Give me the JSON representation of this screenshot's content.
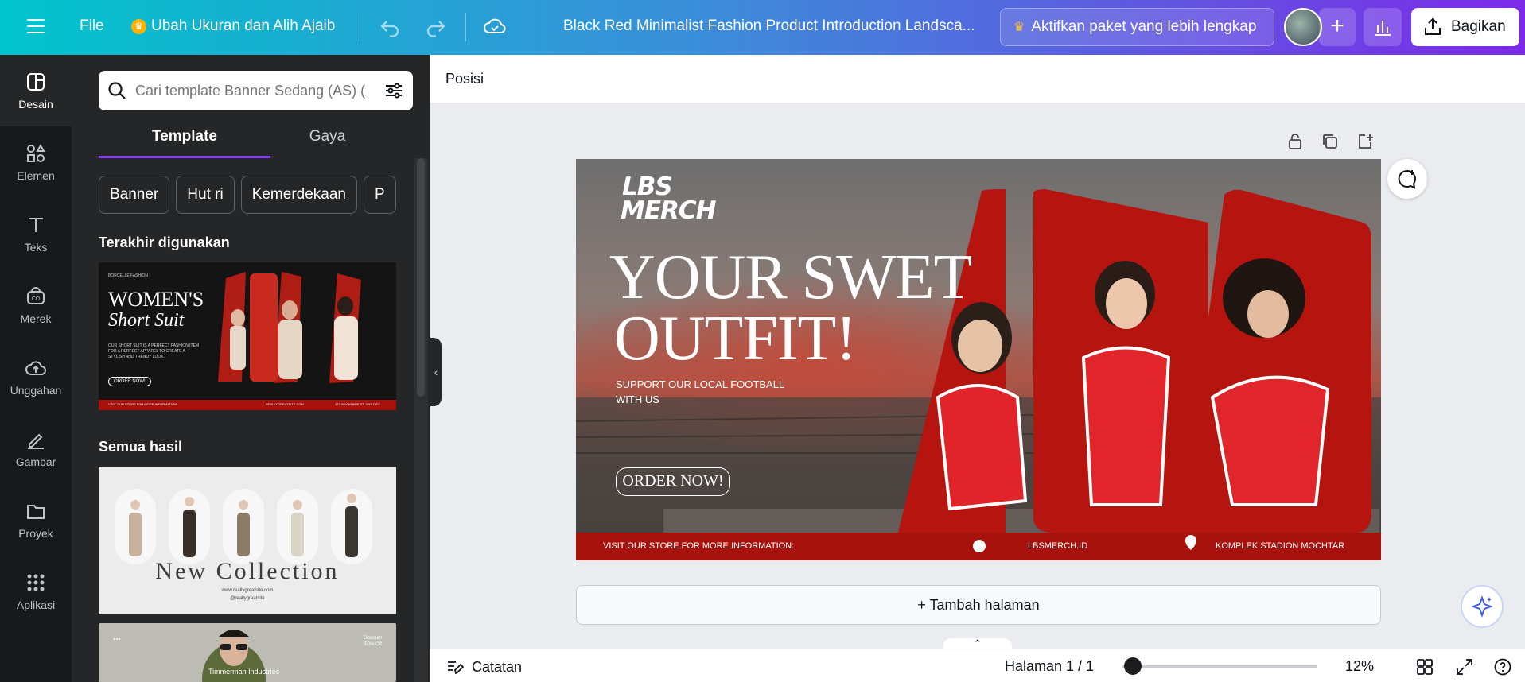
{
  "topbar": {
    "file_label": "File",
    "resize_label": "Ubah Ukuran dan Alih Ajaib",
    "doc_title": "Black Red Minimalist Fashion Product Introduction Landsca...",
    "upgrade_label": "Aktifkan paket yang lebih lengkap",
    "share_label": "Bagikan",
    "icons": [
      "menu-icon",
      "crown-icon",
      "undo-icon",
      "redo-icon",
      "cloud-icon",
      "plus-icon",
      "stats-icon",
      "share-icon"
    ]
  },
  "rail": {
    "items": [
      {
        "label": "Desain",
        "icon": "design-icon"
      },
      {
        "label": "Elemen",
        "icon": "elements-icon"
      },
      {
        "label": "Teks",
        "icon": "text-icon"
      },
      {
        "label": "Merek",
        "icon": "brand-icon"
      },
      {
        "label": "Unggahan",
        "icon": "upload-icon"
      },
      {
        "label": "Gambar",
        "icon": "draw-icon"
      },
      {
        "label": "Proyek",
        "icon": "folder-icon"
      },
      {
        "label": "Aplikasi",
        "icon": "apps-icon"
      }
    ]
  },
  "panel": {
    "search_placeholder": "Cari template Banner Sedang (AS) (",
    "tabs": [
      "Template",
      "Gaya"
    ],
    "chips": [
      "Banner",
      "Hut ri",
      "Kemerdekaan",
      "P"
    ],
    "recent_heading": "Terakhir digunakan",
    "all_heading": "Semua hasil",
    "recent_template": {
      "brand": "BORCELLE FASHION",
      "title_1": "WOMEN'S",
      "title_2": "Short Suit",
      "body": "OUR SHORT SUIT IS A PERFECT FASHION ITEM FOR A PERFECT APPAREL TO CREATE A STYLISH AND TRENDY LOOK.",
      "cta": "ORDER NOW!",
      "footer_left": "VISIT OUR STORE FOR MORE INFORMATION",
      "footer_mid": "REALLYGREATSITE.COM",
      "footer_right": "123 ANYWHERE ST, ANY CITY"
    },
    "result_1": {
      "title": "New Collection",
      "site": "www.reallygreatsite.com",
      "handle": "@reallygreatsite"
    },
    "result_2": {
      "company": "Timmerman Industries",
      "menu": "...",
      "price_1": "Discount",
      "price_2": "50% Off"
    }
  },
  "editor": {
    "position_label": "Posisi",
    "add_page_label": "+ Tambah halaman",
    "page_label": "Halaman 1 / 1",
    "zoom_label": "12%",
    "zoom_level": 0.12,
    "notes_label": "Catatan"
  },
  "design": {
    "logo_1": "LBS",
    "logo_2": "MERCH",
    "headline_1": "YOUR SWET",
    "headline_2": "OUTFIT!",
    "subline_1": "SUPPORT OUR LOCAL FOOTBALL",
    "subline_2": "WITH US",
    "cta": "ORDER NOW!",
    "footer_left": "VISIT OUR STORE FOR MORE INFORMATION:",
    "footer_mid": "LBSMERCH.ID",
    "footer_right": "KOMPLEK STADION MOCHTAR",
    "accent_color": "#b5150e",
    "footer_color": "#a8120c"
  }
}
